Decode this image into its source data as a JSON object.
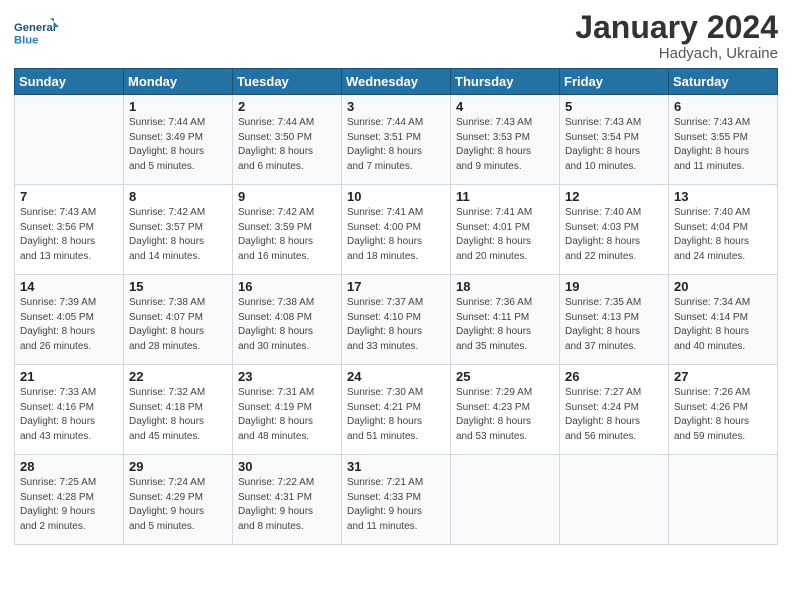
{
  "header": {
    "logo_line1": "General",
    "logo_line2": "Blue",
    "month": "January 2024",
    "location": "Hadyach, Ukraine"
  },
  "days_of_week": [
    "Sunday",
    "Monday",
    "Tuesday",
    "Wednesday",
    "Thursday",
    "Friday",
    "Saturday"
  ],
  "weeks": [
    [
      {
        "day": "",
        "info": ""
      },
      {
        "day": "1",
        "info": "Sunrise: 7:44 AM\nSunset: 3:49 PM\nDaylight: 8 hours\nand 5 minutes."
      },
      {
        "day": "2",
        "info": "Sunrise: 7:44 AM\nSunset: 3:50 PM\nDaylight: 8 hours\nand 6 minutes."
      },
      {
        "day": "3",
        "info": "Sunrise: 7:44 AM\nSunset: 3:51 PM\nDaylight: 8 hours\nand 7 minutes."
      },
      {
        "day": "4",
        "info": "Sunrise: 7:43 AM\nSunset: 3:53 PM\nDaylight: 8 hours\nand 9 minutes."
      },
      {
        "day": "5",
        "info": "Sunrise: 7:43 AM\nSunset: 3:54 PM\nDaylight: 8 hours\nand 10 minutes."
      },
      {
        "day": "6",
        "info": "Sunrise: 7:43 AM\nSunset: 3:55 PM\nDaylight: 8 hours\nand 11 minutes."
      }
    ],
    [
      {
        "day": "7",
        "info": "Sunrise: 7:43 AM\nSunset: 3:56 PM\nDaylight: 8 hours\nand 13 minutes."
      },
      {
        "day": "8",
        "info": "Sunrise: 7:42 AM\nSunset: 3:57 PM\nDaylight: 8 hours\nand 14 minutes."
      },
      {
        "day": "9",
        "info": "Sunrise: 7:42 AM\nSunset: 3:59 PM\nDaylight: 8 hours\nand 16 minutes."
      },
      {
        "day": "10",
        "info": "Sunrise: 7:41 AM\nSunset: 4:00 PM\nDaylight: 8 hours\nand 18 minutes."
      },
      {
        "day": "11",
        "info": "Sunrise: 7:41 AM\nSunset: 4:01 PM\nDaylight: 8 hours\nand 20 minutes."
      },
      {
        "day": "12",
        "info": "Sunrise: 7:40 AM\nSunset: 4:03 PM\nDaylight: 8 hours\nand 22 minutes."
      },
      {
        "day": "13",
        "info": "Sunrise: 7:40 AM\nSunset: 4:04 PM\nDaylight: 8 hours\nand 24 minutes."
      }
    ],
    [
      {
        "day": "14",
        "info": "Sunrise: 7:39 AM\nSunset: 4:05 PM\nDaylight: 8 hours\nand 26 minutes."
      },
      {
        "day": "15",
        "info": "Sunrise: 7:38 AM\nSunset: 4:07 PM\nDaylight: 8 hours\nand 28 minutes."
      },
      {
        "day": "16",
        "info": "Sunrise: 7:38 AM\nSunset: 4:08 PM\nDaylight: 8 hours\nand 30 minutes."
      },
      {
        "day": "17",
        "info": "Sunrise: 7:37 AM\nSunset: 4:10 PM\nDaylight: 8 hours\nand 33 minutes."
      },
      {
        "day": "18",
        "info": "Sunrise: 7:36 AM\nSunset: 4:11 PM\nDaylight: 8 hours\nand 35 minutes."
      },
      {
        "day": "19",
        "info": "Sunrise: 7:35 AM\nSunset: 4:13 PM\nDaylight: 8 hours\nand 37 minutes."
      },
      {
        "day": "20",
        "info": "Sunrise: 7:34 AM\nSunset: 4:14 PM\nDaylight: 8 hours\nand 40 minutes."
      }
    ],
    [
      {
        "day": "21",
        "info": "Sunrise: 7:33 AM\nSunset: 4:16 PM\nDaylight: 8 hours\nand 43 minutes."
      },
      {
        "day": "22",
        "info": "Sunrise: 7:32 AM\nSunset: 4:18 PM\nDaylight: 8 hours\nand 45 minutes."
      },
      {
        "day": "23",
        "info": "Sunrise: 7:31 AM\nSunset: 4:19 PM\nDaylight: 8 hours\nand 48 minutes."
      },
      {
        "day": "24",
        "info": "Sunrise: 7:30 AM\nSunset: 4:21 PM\nDaylight: 8 hours\nand 51 minutes."
      },
      {
        "day": "25",
        "info": "Sunrise: 7:29 AM\nSunset: 4:23 PM\nDaylight: 8 hours\nand 53 minutes."
      },
      {
        "day": "26",
        "info": "Sunrise: 7:27 AM\nSunset: 4:24 PM\nDaylight: 8 hours\nand 56 minutes."
      },
      {
        "day": "27",
        "info": "Sunrise: 7:26 AM\nSunset: 4:26 PM\nDaylight: 8 hours\nand 59 minutes."
      }
    ],
    [
      {
        "day": "28",
        "info": "Sunrise: 7:25 AM\nSunset: 4:28 PM\nDaylight: 9 hours\nand 2 minutes."
      },
      {
        "day": "29",
        "info": "Sunrise: 7:24 AM\nSunset: 4:29 PM\nDaylight: 9 hours\nand 5 minutes."
      },
      {
        "day": "30",
        "info": "Sunrise: 7:22 AM\nSunset: 4:31 PM\nDaylight: 9 hours\nand 8 minutes."
      },
      {
        "day": "31",
        "info": "Sunrise: 7:21 AM\nSunset: 4:33 PM\nDaylight: 9 hours\nand 11 minutes."
      },
      {
        "day": "",
        "info": ""
      },
      {
        "day": "",
        "info": ""
      },
      {
        "day": "",
        "info": ""
      }
    ]
  ]
}
